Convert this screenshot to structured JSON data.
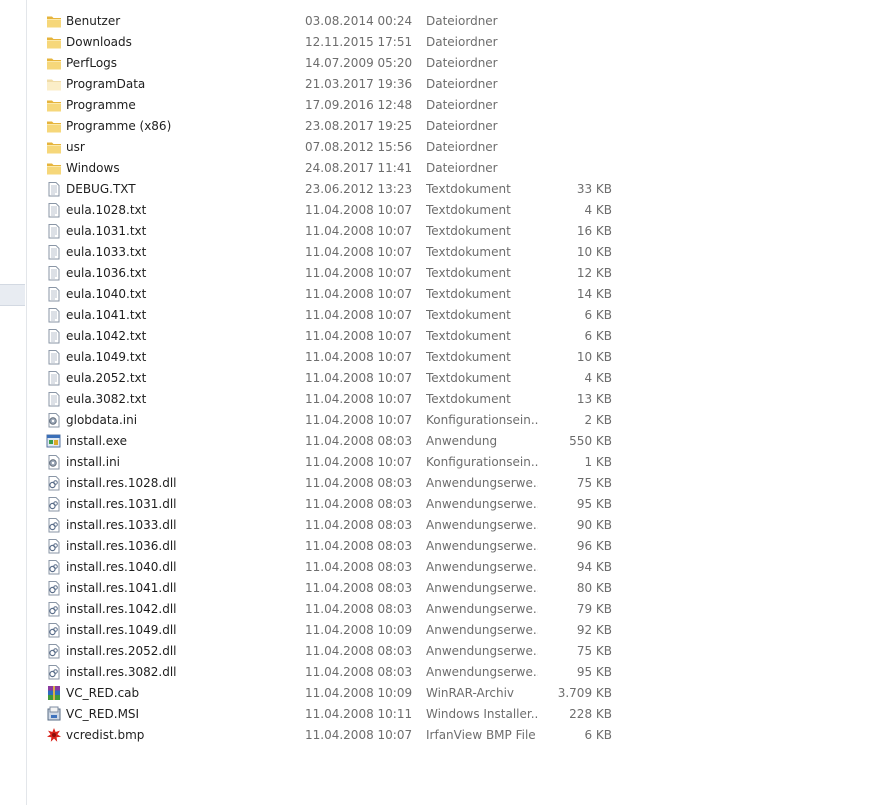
{
  "files": [
    {
      "name": "Benutzer",
      "date": "03.08.2014 00:24",
      "type": "Dateiordner",
      "size": "",
      "icon": "folder-icon"
    },
    {
      "name": "Downloads",
      "date": "12.11.2015 17:51",
      "type": "Dateiordner",
      "size": "",
      "icon": "folder-icon"
    },
    {
      "name": "PerfLogs",
      "date": "14.07.2009 05:20",
      "type": "Dateiordner",
      "size": "",
      "icon": "folder-icon"
    },
    {
      "name": "ProgramData",
      "date": "21.03.2017 19:36",
      "type": "Dateiordner",
      "size": "",
      "icon": "folder-hidden-icon"
    },
    {
      "name": "Programme",
      "date": "17.09.2016 12:48",
      "type": "Dateiordner",
      "size": "",
      "icon": "folder-icon"
    },
    {
      "name": "Programme (x86)",
      "date": "23.08.2017 19:25",
      "type": "Dateiordner",
      "size": "",
      "icon": "folder-icon"
    },
    {
      "name": "usr",
      "date": "07.08.2012 15:56",
      "type": "Dateiordner",
      "size": "",
      "icon": "folder-icon"
    },
    {
      "name": "Windows",
      "date": "24.08.2017 11:41",
      "type": "Dateiordner",
      "size": "",
      "icon": "folder-icon"
    },
    {
      "name": "DEBUG.TXT",
      "date": "23.06.2012 13:23",
      "type": "Textdokument",
      "size": "33 KB",
      "icon": "text-file-icon"
    },
    {
      "name": "eula.1028.txt",
      "date": "11.04.2008 10:07",
      "type": "Textdokument",
      "size": "4 KB",
      "icon": "text-file-icon"
    },
    {
      "name": "eula.1031.txt",
      "date": "11.04.2008 10:07",
      "type": "Textdokument",
      "size": "16 KB",
      "icon": "text-file-icon"
    },
    {
      "name": "eula.1033.txt",
      "date": "11.04.2008 10:07",
      "type": "Textdokument",
      "size": "10 KB",
      "icon": "text-file-icon"
    },
    {
      "name": "eula.1036.txt",
      "date": "11.04.2008 10:07",
      "type": "Textdokument",
      "size": "12 KB",
      "icon": "text-file-icon"
    },
    {
      "name": "eula.1040.txt",
      "date": "11.04.2008 10:07",
      "type": "Textdokument",
      "size": "14 KB",
      "icon": "text-file-icon"
    },
    {
      "name": "eula.1041.txt",
      "date": "11.04.2008 10:07",
      "type": "Textdokument",
      "size": "6 KB",
      "icon": "text-file-icon"
    },
    {
      "name": "eula.1042.txt",
      "date": "11.04.2008 10:07",
      "type": "Textdokument",
      "size": "6 KB",
      "icon": "text-file-icon"
    },
    {
      "name": "eula.1049.txt",
      "date": "11.04.2008 10:07",
      "type": "Textdokument",
      "size": "10 KB",
      "icon": "text-file-icon"
    },
    {
      "name": "eula.2052.txt",
      "date": "11.04.2008 10:07",
      "type": "Textdokument",
      "size": "4 KB",
      "icon": "text-file-icon"
    },
    {
      "name": "eula.3082.txt",
      "date": "11.04.2008 10:07",
      "type": "Textdokument",
      "size": "13 KB",
      "icon": "text-file-icon"
    },
    {
      "name": "globdata.ini",
      "date": "11.04.2008 10:07",
      "type": "Konfigurationsein...",
      "size": "2 KB",
      "icon": "config-file-icon"
    },
    {
      "name": "install.exe",
      "date": "11.04.2008 08:03",
      "type": "Anwendung",
      "size": "550 KB",
      "icon": "application-icon"
    },
    {
      "name": "install.ini",
      "date": "11.04.2008 10:07",
      "type": "Konfigurationsein...",
      "size": "1 KB",
      "icon": "config-file-icon"
    },
    {
      "name": "install.res.1028.dll",
      "date": "11.04.2008 08:03",
      "type": "Anwendungserwe...",
      "size": "75 KB",
      "icon": "dll-file-icon"
    },
    {
      "name": "install.res.1031.dll",
      "date": "11.04.2008 08:03",
      "type": "Anwendungserwe...",
      "size": "95 KB",
      "icon": "dll-file-icon"
    },
    {
      "name": "install.res.1033.dll",
      "date": "11.04.2008 08:03",
      "type": "Anwendungserwe...",
      "size": "90 KB",
      "icon": "dll-file-icon"
    },
    {
      "name": "install.res.1036.dll",
      "date": "11.04.2008 08:03",
      "type": "Anwendungserwe...",
      "size": "96 KB",
      "icon": "dll-file-icon"
    },
    {
      "name": "install.res.1040.dll",
      "date": "11.04.2008 08:03",
      "type": "Anwendungserwe...",
      "size": "94 KB",
      "icon": "dll-file-icon"
    },
    {
      "name": "install.res.1041.dll",
      "date": "11.04.2008 08:03",
      "type": "Anwendungserwe...",
      "size": "80 KB",
      "icon": "dll-file-icon"
    },
    {
      "name": "install.res.1042.dll",
      "date": "11.04.2008 08:03",
      "type": "Anwendungserwe...",
      "size": "79 KB",
      "icon": "dll-file-icon"
    },
    {
      "name": "install.res.1049.dll",
      "date": "11.04.2008 10:09",
      "type": "Anwendungserwe...",
      "size": "92 KB",
      "icon": "dll-file-icon"
    },
    {
      "name": "install.res.2052.dll",
      "date": "11.04.2008 08:03",
      "type": "Anwendungserwe...",
      "size": "75 KB",
      "icon": "dll-file-icon"
    },
    {
      "name": "install.res.3082.dll",
      "date": "11.04.2008 08:03",
      "type": "Anwendungserwe...",
      "size": "95 KB",
      "icon": "dll-file-icon"
    },
    {
      "name": "VC_RED.cab",
      "date": "11.04.2008 10:09",
      "type": "WinRAR-Archiv",
      "size": "3.709 KB",
      "icon": "winrar-archive-icon"
    },
    {
      "name": "VC_RED.MSI",
      "date": "11.04.2008 10:11",
      "type": "Windows Installer...",
      "size": "228 KB",
      "icon": "msi-installer-icon"
    },
    {
      "name": "vcredist.bmp",
      "date": "11.04.2008 10:07",
      "type": "IrfanView BMP File",
      "size": "6 KB",
      "icon": "irfanview-bmp-icon"
    }
  ]
}
